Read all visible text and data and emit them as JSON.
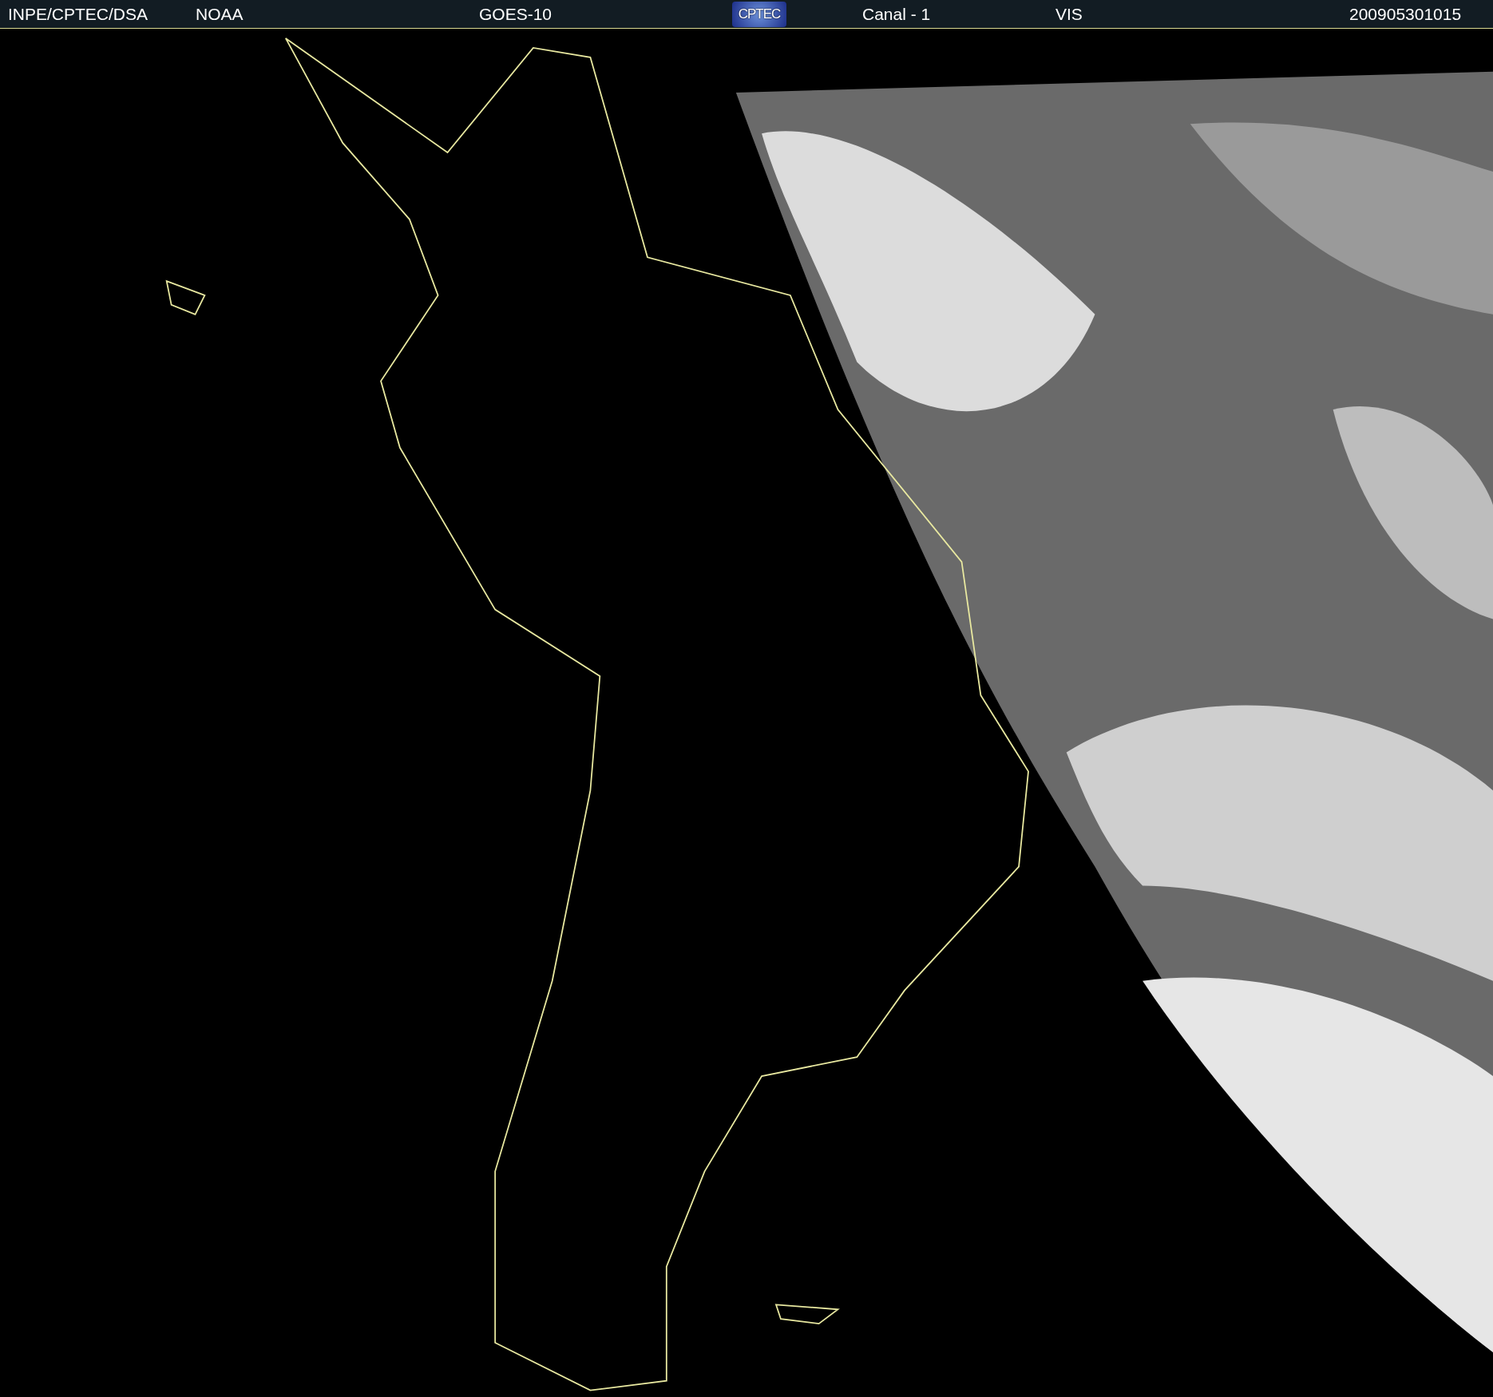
{
  "header": {
    "items": [
      {
        "kind": "text",
        "text": "INPE/CPTEC/DSA"
      },
      {
        "kind": "text",
        "text": "NOAA"
      },
      {
        "kind": "text",
        "text": "GOES-10"
      },
      {
        "kind": "logo",
        "text": "CPTEC"
      },
      {
        "kind": "text",
        "text": "Canal - 1"
      },
      {
        "kind": "text",
        "text": "VIS"
      },
      {
        "kind": "text",
        "text": "200905301015"
      }
    ]
  }
}
